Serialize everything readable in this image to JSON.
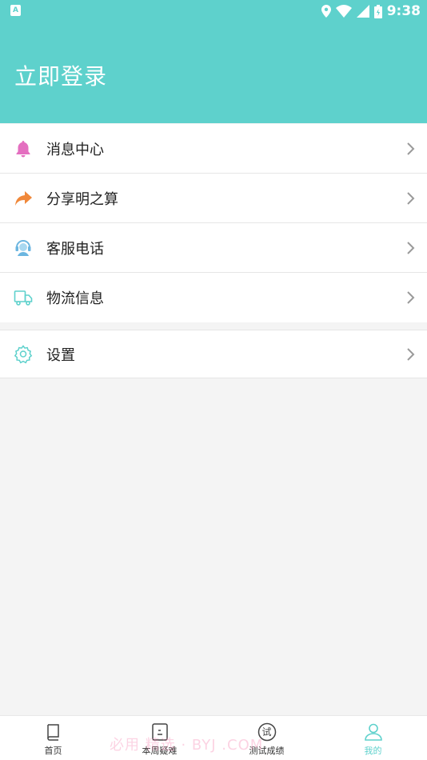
{
  "status_bar": {
    "time": "9:38",
    "left_icon_letter": "A"
  },
  "header": {
    "login_label": "立即登录"
  },
  "menu": {
    "items": [
      {
        "label": "消息中心",
        "icon": "bell-icon"
      },
      {
        "label": "分享明之算",
        "icon": "share-arrow-icon"
      },
      {
        "label": "客服电话",
        "icon": "headset-icon"
      },
      {
        "label": "物流信息",
        "icon": "truck-icon"
      }
    ],
    "settings": {
      "label": "设置",
      "icon": "gear-icon"
    }
  },
  "tabbar": {
    "tabs": [
      {
        "label": "首页",
        "icon": "book-icon"
      },
      {
        "label": "本周疑难",
        "icon": "note-icon"
      },
      {
        "label": "测试成绩",
        "icon": "test-badge-icon",
        "badge": "试"
      },
      {
        "label": "我的",
        "icon": "user-icon"
      }
    ],
    "active": "我的"
  },
  "watermark": "必用 精选 · BYJ .COM",
  "colors": {
    "accent": "#5ed1cc",
    "bell": "#e46fc0",
    "share": "#f0883a",
    "service": "#6cb6e0",
    "truck": "#5ed1cc"
  }
}
